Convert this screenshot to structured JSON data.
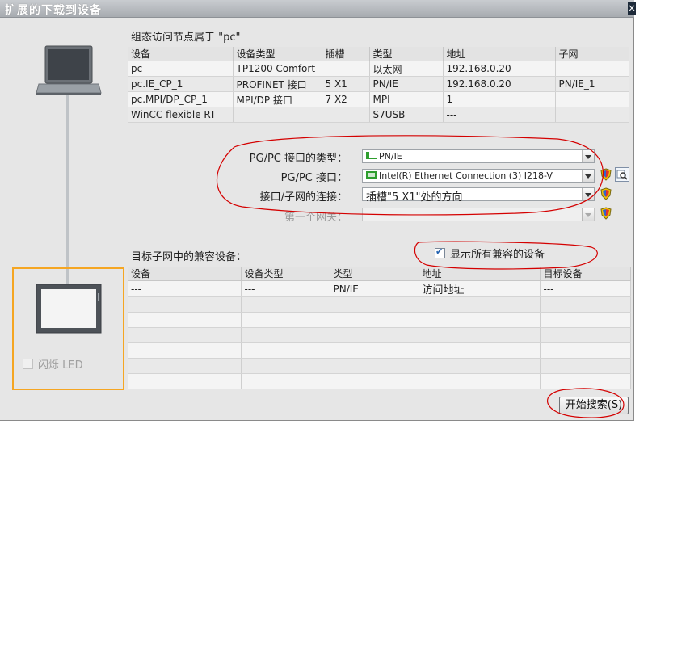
{
  "dialog": {
    "title": "扩展的下载到设备",
    "close_glyph": "×"
  },
  "nodes": {
    "section_title": "组态访问节点属于 \"pc\"",
    "columns": [
      "设备",
      "设备类型",
      "插槽",
      "类型",
      "地址",
      "子网"
    ],
    "rows": [
      [
        "pc",
        "TP1200 Comfort",
        "",
        "以太网",
        "192.168.0.20",
        ""
      ],
      [
        "pc.IE_CP_1",
        "PROFINET 接口",
        "5 X1",
        "PN/IE",
        "192.168.0.20",
        "PN/IE_1"
      ],
      [
        "pc.MPI/DP_CP_1",
        "MPI/DP 接口",
        "7 X2",
        "MPI",
        "1",
        ""
      ],
      [
        "WinCC flexible RT",
        "",
        "",
        "S7USB",
        "---",
        ""
      ]
    ]
  },
  "settings": {
    "interface_type_label": "PG/PC 接口的类型：",
    "interface_type_value": "PN/IE",
    "interface_label": "PG/PC 接口：",
    "interface_value": "Intel(R) Ethernet Connection (3) I218-V",
    "connection_label": "接口/子网的连接：",
    "connection_value": "插槽\"5 X1\"处的方向",
    "gateway_label": "第一个网关：",
    "gateway_value": ""
  },
  "compatible": {
    "section_title": "目标子网中的兼容设备：",
    "show_all_label": "显示所有兼容的设备",
    "show_all_checked": true,
    "columns": [
      "设备",
      "设备类型",
      "类型",
      "地址",
      "目标设备"
    ],
    "rows": [
      [
        "---",
        "---",
        "PN/IE",
        "访问地址",
        "---"
      ],
      [
        "",
        "",
        "",
        "",
        ""
      ],
      [
        "",
        "",
        "",
        "",
        ""
      ],
      [
        "",
        "",
        "",
        "",
        ""
      ],
      [
        "",
        "",
        "",
        "",
        ""
      ],
      [
        "",
        "",
        "",
        "",
        ""
      ],
      [
        "",
        "",
        "",
        "",
        ""
      ]
    ]
  },
  "flash_led_label": "闪烁 LED",
  "search_button_label": "开始搜索(S)",
  "colors": {
    "highlight_box": "#f5a623",
    "annotation": "#d40000",
    "network_green": "#2e9e2e"
  }
}
